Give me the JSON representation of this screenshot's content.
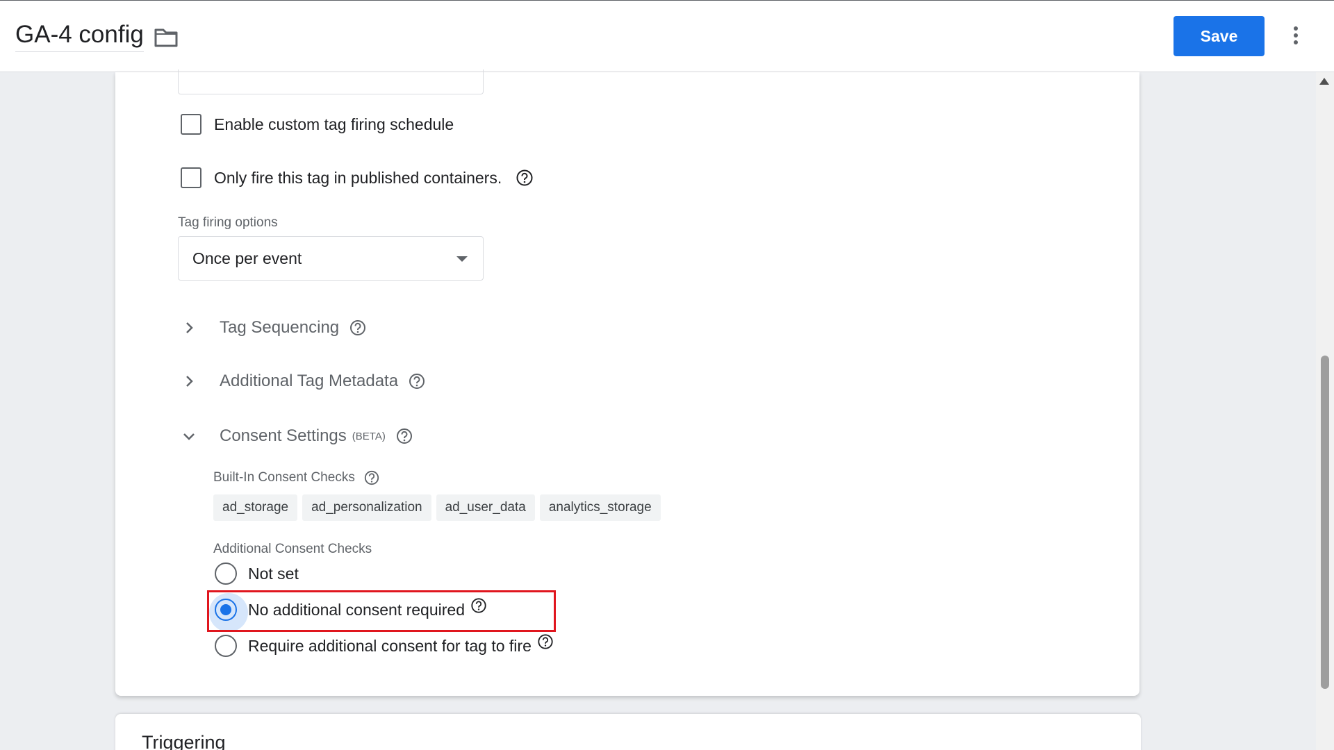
{
  "header": {
    "title": "GA-4 config",
    "save_label": "Save"
  },
  "form": {
    "custom_schedule_label": "Enable custom tag firing schedule",
    "published_only_label": "Only fire this tag in published containers.",
    "tag_firing_options_label": "Tag firing options",
    "tag_firing_options_value": "Once per event",
    "sections": {
      "tag_sequencing": "Tag Sequencing",
      "additional_metadata": "Additional Tag Metadata",
      "consent_settings": "Consent Settings",
      "consent_beta": "(BETA)"
    },
    "built_in_label": "Built-In Consent Checks",
    "built_in_chips": [
      "ad_storage",
      "ad_personalization",
      "ad_user_data",
      "analytics_storage"
    ],
    "additional_label": "Additional Consent Checks",
    "radio_options": [
      {
        "label": "Not set",
        "checked": false
      },
      {
        "label": "No additional consent required",
        "checked": true
      },
      {
        "label": "Require additional consent for tag to fire",
        "checked": false
      }
    ]
  },
  "triggering": {
    "title": "Triggering"
  },
  "colors": {
    "accent": "#1a73e8",
    "highlight": "#e0161e"
  }
}
